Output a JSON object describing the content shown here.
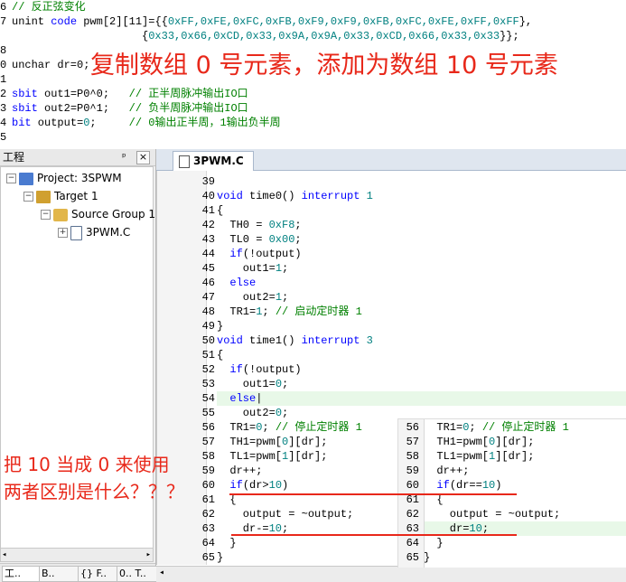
{
  "top_code": [
    {
      "ln": "6",
      "segs": [
        {
          "t": "// 反正弦变化",
          "c": "cm"
        }
      ]
    },
    {
      "ln": "7",
      "segs": [
        {
          "t": "unint ",
          "c": ""
        },
        {
          "t": "code",
          "c": "kw"
        },
        {
          "t": " pwm[2][11]={{",
          "c": ""
        },
        {
          "t": "0xFF,0xFE,0xFC,0xFB,0xF9,0xF9,0xFB,0xFC,0xFE,0xFF,0xFF",
          "c": "num"
        },
        {
          "t": "},",
          "c": ""
        }
      ]
    },
    {
      "ln": "",
      "segs": [
        {
          "t": "                    {",
          "c": ""
        },
        {
          "t": "0x33,0x66,0xCD,0x33,0x9A,0x9A,0x33,0xCD,0x66,0x33,0x33",
          "c": "num"
        },
        {
          "t": "}};",
          "c": ""
        }
      ]
    },
    {
      "ln": "8",
      "segs": []
    },
    {
      "ln": "0",
      "segs": [
        {
          "t": "unchar dr=0;",
          "c": ""
        }
      ]
    },
    {
      "ln": "1",
      "segs": []
    },
    {
      "ln": "2",
      "segs": [
        {
          "t": "sbit",
          "c": "kw"
        },
        {
          "t": " out1=P0^0;   ",
          "c": ""
        },
        {
          "t": "// 正半周脉冲输出IO口",
          "c": "cm"
        }
      ]
    },
    {
      "ln": "3",
      "segs": [
        {
          "t": "sbit",
          "c": "kw"
        },
        {
          "t": " out2=P0^1;   ",
          "c": ""
        },
        {
          "t": "// 负半周脉冲输出IO口",
          "c": "cm"
        }
      ]
    },
    {
      "ln": "4",
      "segs": [
        {
          "t": "bit",
          "c": "kw"
        },
        {
          "t": " output=",
          "c": ""
        },
        {
          "t": "0",
          "c": "num"
        },
        {
          "t": ";     ",
          "c": ""
        },
        {
          "t": "// 0输出正半周，1输出负半周",
          "c": "cm"
        }
      ]
    },
    {
      "ln": "5",
      "segs": []
    }
  ],
  "annotation_top": "复制数组 0 号元素，添加为数组 10 号元素",
  "annotation_left": [
    "把 10 当成 0 来使用",
    "两者区别是什么？？？"
  ],
  "project_panel": {
    "title": "工程",
    "pin": "ᵖ",
    "close": "×",
    "tree": [
      {
        "label": "Project: 3SPWM",
        "depth": 0,
        "toggle": "−",
        "icon": "project"
      },
      {
        "label": "Target 1",
        "depth": 1,
        "toggle": "−",
        "icon": "target"
      },
      {
        "label": "Source Group 1",
        "depth": 2,
        "toggle": "−",
        "icon": "folder"
      },
      {
        "label": "3PWM.C",
        "depth": 3,
        "toggle": "+",
        "icon": "file"
      }
    ],
    "bottom_tabs": [
      "工..",
      "B..",
      "{} F..",
      "0.. T.."
    ]
  },
  "editor": {
    "tab_label": "3PWM.C",
    "lines": [
      {
        "ln": "39",
        "segs": []
      },
      {
        "ln": "40",
        "segs": [
          {
            "t": "void",
            "c": "kw"
          },
          {
            "t": " time0() ",
            "c": ""
          },
          {
            "t": "interrupt",
            "c": "kw"
          },
          {
            "t": " ",
            "c": ""
          },
          {
            "t": "1",
            "c": "num"
          }
        ]
      },
      {
        "ln": "41",
        "segs": [
          {
            "t": "{",
            "c": ""
          }
        ]
      },
      {
        "ln": "42",
        "segs": [
          {
            "t": "  TH0 = ",
            "c": ""
          },
          {
            "t": "0xF8",
            "c": "num"
          },
          {
            "t": ";",
            "c": ""
          }
        ]
      },
      {
        "ln": "43",
        "segs": [
          {
            "t": "  TL0 = ",
            "c": ""
          },
          {
            "t": "0x00",
            "c": "num"
          },
          {
            "t": ";",
            "c": ""
          }
        ]
      },
      {
        "ln": "44",
        "segs": [
          {
            "t": "  ",
            "c": ""
          },
          {
            "t": "if",
            "c": "kw"
          },
          {
            "t": "(!output)",
            "c": ""
          }
        ]
      },
      {
        "ln": "45",
        "segs": [
          {
            "t": "    out1=",
            "c": ""
          },
          {
            "t": "1",
            "c": "num"
          },
          {
            "t": ";",
            "c": ""
          }
        ]
      },
      {
        "ln": "46",
        "segs": [
          {
            "t": "  ",
            "c": ""
          },
          {
            "t": "else",
            "c": "kw"
          }
        ]
      },
      {
        "ln": "47",
        "segs": [
          {
            "t": "    out2=",
            "c": ""
          },
          {
            "t": "1",
            "c": "num"
          },
          {
            "t": ";",
            "c": ""
          }
        ]
      },
      {
        "ln": "48",
        "segs": [
          {
            "t": "  TR1=",
            "c": ""
          },
          {
            "t": "1",
            "c": "num"
          },
          {
            "t": "; ",
            "c": ""
          },
          {
            "t": "// 启动定时器 1",
            "c": "cm"
          }
        ]
      },
      {
        "ln": "49",
        "segs": [
          {
            "t": "}",
            "c": ""
          }
        ]
      },
      {
        "ln": "50",
        "segs": [
          {
            "t": "void",
            "c": "kw"
          },
          {
            "t": " time1() ",
            "c": ""
          },
          {
            "t": "interrupt",
            "c": "kw"
          },
          {
            "t": " ",
            "c": ""
          },
          {
            "t": "3",
            "c": "num"
          }
        ]
      },
      {
        "ln": "51",
        "segs": [
          {
            "t": "{",
            "c": ""
          }
        ]
      },
      {
        "ln": "52",
        "segs": [
          {
            "t": "  ",
            "c": ""
          },
          {
            "t": "if",
            "c": "kw"
          },
          {
            "t": "(!output)",
            "c": ""
          }
        ]
      },
      {
        "ln": "53",
        "segs": [
          {
            "t": "    out1=",
            "c": ""
          },
          {
            "t": "0",
            "c": "num"
          },
          {
            "t": ";",
            "c": ""
          }
        ]
      },
      {
        "ln": "54",
        "segs": [
          {
            "t": "  ",
            "c": ""
          },
          {
            "t": "else",
            "c": "kw"
          },
          {
            "t": "|",
            "c": ""
          }
        ],
        "highlight": true
      },
      {
        "ln": "55",
        "segs": [
          {
            "t": "    out2=",
            "c": ""
          },
          {
            "t": "0",
            "c": "num"
          },
          {
            "t": ";",
            "c": ""
          }
        ]
      },
      {
        "ln": "56",
        "segs": [
          {
            "t": "  TR1=",
            "c": ""
          },
          {
            "t": "0",
            "c": "num"
          },
          {
            "t": "; ",
            "c": ""
          },
          {
            "t": "// 停止定时器 1",
            "c": "cm"
          }
        ]
      },
      {
        "ln": "57",
        "segs": [
          {
            "t": "  TH1=pwm[",
            "c": ""
          },
          {
            "t": "0",
            "c": "num"
          },
          {
            "t": "][dr];",
            "c": ""
          }
        ]
      },
      {
        "ln": "58",
        "segs": [
          {
            "t": "  TL1=pwm[",
            "c": ""
          },
          {
            "t": "1",
            "c": "num"
          },
          {
            "t": "][dr];",
            "c": ""
          }
        ]
      },
      {
        "ln": "59",
        "segs": [
          {
            "t": "  dr++;",
            "c": ""
          }
        ]
      },
      {
        "ln": "60",
        "segs": [
          {
            "t": "  ",
            "c": ""
          },
          {
            "t": "if",
            "c": "kw"
          },
          {
            "t": "(dr>",
            "c": ""
          },
          {
            "t": "10",
            "c": "num"
          },
          {
            "t": ")",
            "c": ""
          }
        ]
      },
      {
        "ln": "61",
        "segs": [
          {
            "t": "  {",
            "c": ""
          }
        ]
      },
      {
        "ln": "62",
        "segs": [
          {
            "t": "    output = ~output;",
            "c": ""
          }
        ]
      },
      {
        "ln": "63",
        "segs": [
          {
            "t": "    dr-=",
            "c": ""
          },
          {
            "t": "10",
            "c": "num"
          },
          {
            "t": ";",
            "c": ""
          }
        ]
      },
      {
        "ln": "64",
        "segs": [
          {
            "t": "  }",
            "c": ""
          }
        ]
      },
      {
        "ln": "65",
        "segs": [
          {
            "t": "}",
            "c": ""
          }
        ]
      }
    ]
  },
  "overlay": {
    "lines": [
      {
        "ln": "56",
        "segs": [
          {
            "t": "  TR1=",
            "c": ""
          },
          {
            "t": "0",
            "c": "num"
          },
          {
            "t": "; ",
            "c": ""
          },
          {
            "t": "// 停止定时器 1",
            "c": "cm"
          }
        ]
      },
      {
        "ln": "57",
        "segs": [
          {
            "t": "  TH1=pwm[",
            "c": ""
          },
          {
            "t": "0",
            "c": "num"
          },
          {
            "t": "][dr];",
            "c": ""
          }
        ]
      },
      {
        "ln": "58",
        "segs": [
          {
            "t": "  TL1=pwm[",
            "c": ""
          },
          {
            "t": "1",
            "c": "num"
          },
          {
            "t": "][dr];",
            "c": ""
          }
        ]
      },
      {
        "ln": "59",
        "segs": [
          {
            "t": "  dr++;",
            "c": ""
          }
        ]
      },
      {
        "ln": "60",
        "segs": [
          {
            "t": "  ",
            "c": ""
          },
          {
            "t": "if",
            "c": "kw"
          },
          {
            "t": "(dr==",
            "c": ""
          },
          {
            "t": "10",
            "c": "num"
          },
          {
            "t": ")",
            "c": ""
          }
        ]
      },
      {
        "ln": "61",
        "segs": [
          {
            "t": "  {",
            "c": ""
          }
        ]
      },
      {
        "ln": "62",
        "segs": [
          {
            "t": "    output = ~output;",
            "c": ""
          }
        ]
      },
      {
        "ln": "63",
        "segs": [
          {
            "t": "    dr=",
            "c": ""
          },
          {
            "t": "10",
            "c": "num"
          },
          {
            "t": ";",
            "c": ""
          }
        ],
        "highlight": true
      },
      {
        "ln": "64",
        "segs": [
          {
            "t": "  }",
            "c": ""
          }
        ]
      },
      {
        "ln": "65",
        "segs": [
          {
            "t": "}",
            "c": ""
          }
        ]
      }
    ]
  },
  "colors": {
    "annotation": "#e8281a",
    "keyword": "#0000ff",
    "comment": "#008000",
    "number": "#008080",
    "line_highlight": "#e8f8e8"
  }
}
